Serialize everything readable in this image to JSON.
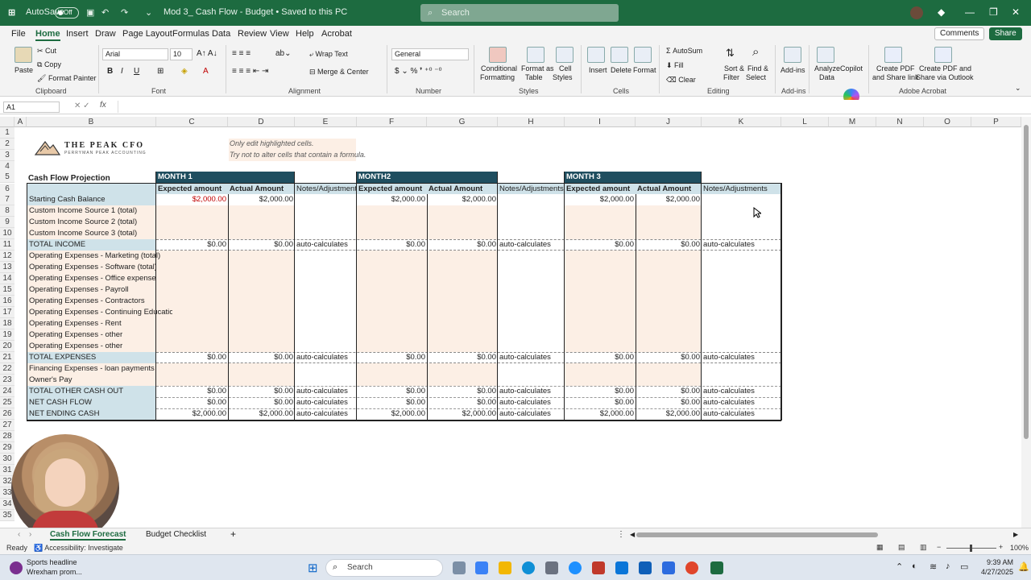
{
  "titlebar": {
    "autosave_label": "AutoSave",
    "autosave_state": "Off",
    "doc_title": "Mod 3_ Cash Flow - Budget • Saved to this PC",
    "search_placeholder": "Search"
  },
  "menu": [
    "File",
    "Home",
    "Insert",
    "Draw",
    "Page Layout",
    "Formulas",
    "Data",
    "Review",
    "View",
    "Help",
    "Acrobat"
  ],
  "topbuttons": {
    "comments": "Comments",
    "share": "Share"
  },
  "ribbon": {
    "clipboard": {
      "paste": "Paste",
      "cut": "Cut",
      "copy": "Copy",
      "format_painter": "Format Painter",
      "group": "Clipboard"
    },
    "font": {
      "name": "Arial",
      "size": "10",
      "group": "Font"
    },
    "alignment": {
      "wrap": "Wrap Text",
      "merge": "Merge & Center",
      "group": "Alignment"
    },
    "number": {
      "format": "General",
      "group": "Number"
    },
    "styles": {
      "conditional": "Conditional",
      "formatting": "Formatting",
      "format_as": "Format as",
      "table": "Table",
      "cell": "Cell",
      "cell_styles": "Styles",
      "group": "Styles"
    },
    "cells": {
      "insert": "Insert",
      "delete": "Delete",
      "format": "Format",
      "group": "Cells"
    },
    "editing": {
      "autosum": "AutoSum",
      "fill": "Fill",
      "clear": "Clear",
      "sort": "Sort &",
      "filter": "Filter",
      "find": "Find &",
      "select": "Select",
      "group": "Editing"
    },
    "addins": {
      "addins": "Add-ins",
      "group": "Add-ins"
    },
    "analyze": {
      "analyze": "Analyze",
      "data": "Data",
      "copilot": "Copilot"
    },
    "acrobat": {
      "pdf1a": "Create PDF",
      "pdf1b": "and Share link",
      "pdf2a": "Create PDF and",
      "pdf2b": "Share via Outlook",
      "group": "Adobe Acrobat"
    }
  },
  "formulabar": {
    "namebox": "A1",
    "fx": "fx"
  },
  "columns": [
    "A",
    "B",
    "C",
    "D",
    "E",
    "F",
    "G",
    "H",
    "I",
    "J",
    "K",
    "L",
    "M",
    "N",
    "O",
    "P"
  ],
  "rows": [
    "1",
    "2",
    "3",
    "4",
    "5",
    "6",
    "7",
    "8",
    "9",
    "10",
    "11",
    "12",
    "13",
    "14",
    "15",
    "16",
    "17",
    "18",
    "19",
    "20",
    "21",
    "22",
    "23",
    "24",
    "25",
    "26",
    "27",
    "28",
    "29",
    "30",
    "31",
    "32",
    "33",
    "34",
    "35"
  ],
  "sheet": {
    "logo_title": "THE PEAK CFO",
    "logo_sub": "PERRYMAN PEAK ACCOUNTING",
    "note1": "Only edit highlighted cells.",
    "note2": "Try not to alter cells that contain a formula.",
    "projection_title": "Cash Flow Projection",
    "month1": "MONTH 1",
    "month2": "MONTH2",
    "month3": "MONTH 3",
    "expected": "Expected amount",
    "actual": "Actual Amount",
    "notes": "Notes/Adjustments",
    "labels": {
      "r7": "Starting Cash Balance",
      "r8": "Custom Income Source 1 (total)",
      "r9": "Custom Income Source 2 (total)",
      "r10": "Custom Income Source 3 (total)",
      "r11": "TOTAL INCOME",
      "r12": "Operating Expenses - Marketing (total)",
      "r13": "Operating Expenses - Software (total)",
      "r14": "Operating Expenses - Office expenses",
      "r15": "Operating Expenses - Payroll",
      "r16": "Operating Expenses - Contractors",
      "r17": "Operating Expenses - Continuing Education",
      "r18": "Operating Expenses - Rent",
      "r19": "Operating Expenses - other",
      "r20": "Operating Expenses - other",
      "r21": "TOTAL EXPENSES",
      "r22": "Financing Expenses - loan payments",
      "r23": "Owner's Pay",
      "r24": "TOTAL OTHER CASH OUT",
      "r25": "NET CASH FLOW",
      "r26": "NET ENDING CASH"
    },
    "v2000": "$2,000.00",
    "v0": "$0.00",
    "auto": "auto-calculates"
  },
  "sheettabs": {
    "active": "Cash Flow Forecast",
    "other": "Budget Checklist",
    "add": "+"
  },
  "status": {
    "ready": "Ready",
    "accessibility": "Accessibility: Investigate",
    "zoom": "100%"
  },
  "taskbar": {
    "news_title": "Sports headline",
    "news_sub": "Wrexham prom...",
    "search": "Search",
    "time": "9:39 AM",
    "date": "4/27/2025"
  }
}
